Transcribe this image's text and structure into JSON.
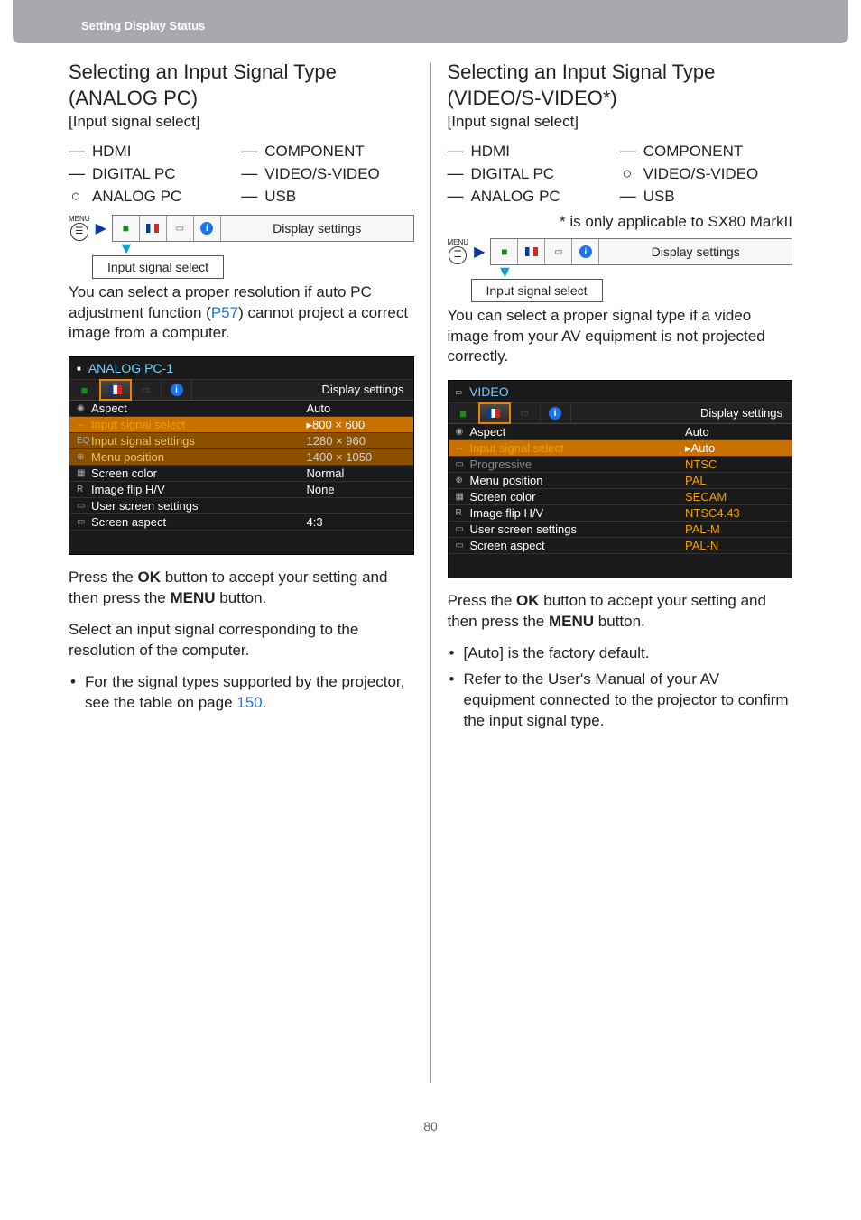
{
  "header": "Setting Display Status",
  "page_number": "80",
  "left": {
    "title": "Selecting an Input Signal Type (ANALOG PC)",
    "subhead": "[Input signal select]",
    "signals": [
      {
        "mark": "—",
        "label": "HDMI"
      },
      {
        "mark": "—",
        "label": "COMPONENT"
      },
      {
        "mark": "—",
        "label": "DIGITAL PC"
      },
      {
        "mark": "—",
        "label": "VIDEO/S-VIDEO"
      },
      {
        "mark": "○",
        "label": "ANALOG PC"
      },
      {
        "mark": "—",
        "label": "USB"
      }
    ],
    "menubar_label": "Display settings",
    "callout": "Input signal select",
    "para1a": "You can select a proper resolution if auto PC adjustment function (",
    "para1_link": "P57",
    "para1b": ") cannot project a correct image from a computer.",
    "osd": {
      "title": "ANALOG PC-1",
      "tab_label": "Display settings",
      "rows": [
        {
          "icon": "◉",
          "label": "Aspect",
          "value": "Auto",
          "cls": ""
        },
        {
          "icon": "↔",
          "label": "Input signal select",
          "value": "▸800 × 600",
          "cls": "hl"
        },
        {
          "icon": "EQ",
          "label": "Input signal settings",
          "value": "1280 × 960",
          "cls": "hl2"
        },
        {
          "icon": "⊕",
          "label": "Menu position",
          "value": "1400 × 1050",
          "cls": "hl2"
        },
        {
          "icon": "▦",
          "label": "Screen color",
          "value": "Normal",
          "cls": ""
        },
        {
          "icon": "R",
          "label": "Image flip H/V",
          "value": "None",
          "cls": ""
        },
        {
          "icon": "▭",
          "label": "User screen settings",
          "value": "",
          "cls": ""
        },
        {
          "icon": "▭",
          "label": "Screen aspect",
          "value": "4:3",
          "cls": ""
        }
      ]
    },
    "para2a": "Press the ",
    "para2b": " button to accept your setting and then press the ",
    "para2c": " button.",
    "ok": "OK",
    "menu": "MENU",
    "para3": "Select an input signal corresponding to the resolution of the computer.",
    "bullet1a": "For the signal types supported by the projector, see the table on page ",
    "bullet1_link": "150",
    "bullet1b": "."
  },
  "right": {
    "title": "Selecting an Input Signal Type (VIDEO/S-VIDEO*)",
    "subhead": "[Input signal select]",
    "signals": [
      {
        "mark": "—",
        "label": "HDMI"
      },
      {
        "mark": "—",
        "label": "COMPONENT"
      },
      {
        "mark": "—",
        "label": "DIGITAL PC"
      },
      {
        "mark": "○",
        "label": "VIDEO/S-VIDEO"
      },
      {
        "mark": "—",
        "label": "ANALOG PC"
      },
      {
        "mark": "—",
        "label": "USB"
      }
    ],
    "footnote": "* is only applicable to SX80 MarkII",
    "menubar_label": "Display settings",
    "callout": "Input signal select",
    "para1": "You can select a proper signal type if a video image from your AV equipment is not projected correctly.",
    "osd": {
      "title": "VIDEO",
      "tab_label": "Display settings",
      "rows": [
        {
          "icon": "◉",
          "label": "Aspect",
          "value": "Auto",
          "cls": ""
        },
        {
          "icon": "↔",
          "label": "Input signal select",
          "value": "▸Auto",
          "cls": "hl"
        },
        {
          "icon": "▭",
          "label": "Progressive",
          "value": "NTSC",
          "cls": "dim"
        },
        {
          "icon": "⊕",
          "label": "Menu position",
          "value": "PAL",
          "cls": "video-sub"
        },
        {
          "icon": "▦",
          "label": "Screen color",
          "value": "SECAM",
          "cls": "video-sub"
        },
        {
          "icon": "R",
          "label": "Image flip H/V",
          "value": "NTSC4.43",
          "cls": "video-sub"
        },
        {
          "icon": "▭",
          "label": "User screen settings",
          "value": "PAL-M",
          "cls": "video-sub"
        },
        {
          "icon": "▭",
          "label": "Screen aspect",
          "value": "PAL-N",
          "cls": "video-sub"
        }
      ]
    },
    "para2a": "Press the ",
    "para2b": " button to accept your setting and then press the ",
    "para2c": " button.",
    "ok": "OK",
    "menu": "MENU",
    "bullets": [
      "[Auto] is the factory default.",
      "Refer to the User's Manual of your AV equipment connected to the projector to confirm the input signal type."
    ]
  },
  "menu_label": "MENU"
}
